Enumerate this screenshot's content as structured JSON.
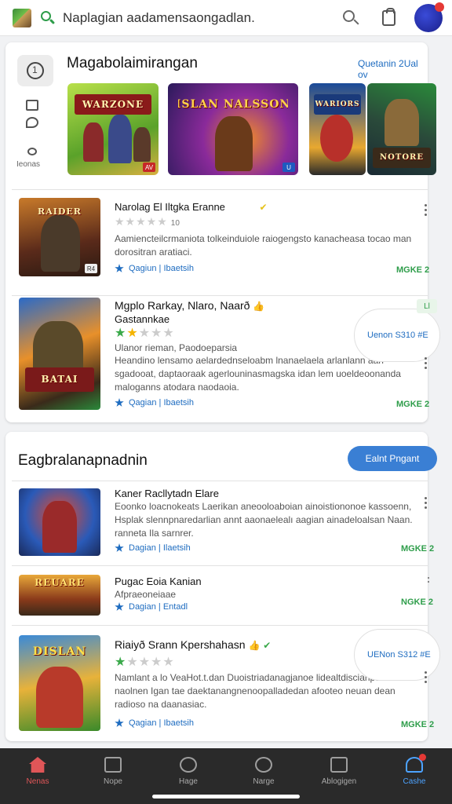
{
  "topbar": {
    "search_text": "Naplagian aadamensaongadlan."
  },
  "featured": {
    "title": "Magabolaimirangan",
    "see_all": "Quetanin 2Ual ov",
    "side_label": "Ieonas",
    "thumbs": [
      {
        "banner": "WARZONE",
        "corner": "AV",
        "colors": [
          "#9bd33a",
          "#e1c13a"
        ]
      },
      {
        "banner": "ISLAN NALSSON",
        "corner": "U",
        "colors": [
          "#3a2a7a",
          "#c8409a"
        ]
      },
      {
        "banner": "WARIORS",
        "corner": "",
        "colors": [
          "#1d4a8a",
          "#e8a830"
        ]
      },
      {
        "banner": "NOTORE",
        "corner": "",
        "colors": [
          "#2c5a2a",
          "#1a3344"
        ]
      }
    ],
    "items": [
      {
        "title": "Narolag El Iltgka Eranne",
        "rating_count": "10",
        "desc": "Aamiencteilcrmaniota tolkeinduiole raiogengsto kanacheasa tocao man dorositran aratiaci.",
        "tags": "Qagiun | Ibaetsih",
        "more": "MGKE 2",
        "thumb_banner": "RAIDER",
        "thumb_corner": "R4"
      },
      {
        "title": "Mgplo Rarkay, Nlaro, Naarð",
        "title2": "Gastannkae",
        "desc_head": "Ulanor rieman, Paodoeparsia",
        "desc": "Heandino lensamo aelardednseloabm lnanaelaela arlanlann aan sgadooat, daptaoraak agerlouninasmagska idan lem uoeldeoonanda maloganns atodara naodaoia.",
        "tags": "Qagian | Ibaetsih",
        "more": "MGKE 2",
        "pill": "Uenon  S310 #E",
        "badge": "Ll",
        "thumb_banner": "BATAI",
        "thumb_corner": ""
      }
    ]
  },
  "section2": {
    "title": "Eagbralanapnadnin",
    "button": "Ealnt  Pngant",
    "items": [
      {
        "title": "Kaner Racllytadn Elare",
        "desc": "Eoonko loacnokeats Laerikan aneooloaboian ainoistiononoe kassoenn, Hsplak slennpnaredarlian annt aaonaelealı aagian ainadeloalsan Naan. ranneta Ila sarnrer.",
        "tags": "Dagian | Ilaetsih",
        "more": "MGKE 2"
      },
      {
        "title": "Pugac Eoia Kanian",
        "desc": "Afpraeoneiaae",
        "tags": "Dagian | Entadl",
        "more": "NGKE 2"
      },
      {
        "title": "Riaiyð Srann Kpershahasn",
        "desc": "Namlant a lo VeaHot.t.dan Duoistriadanagjanoe lidealtdiscianpanenteai. naolnen Igan tae daektanangnenoopalladedan afooteo neuan dean radioso na daanasiac.",
        "tags": "Qagian | Ibaetsih",
        "more": "MGKE 2",
        "pill": "UENon  S312 #E"
      }
    ]
  },
  "nav": [
    {
      "label": "Nenas"
    },
    {
      "label": "Nope"
    },
    {
      "label": "Hage"
    },
    {
      "label": "Narge"
    },
    {
      "label": "Ablogigen"
    },
    {
      "label": "Cashe"
    }
  ]
}
